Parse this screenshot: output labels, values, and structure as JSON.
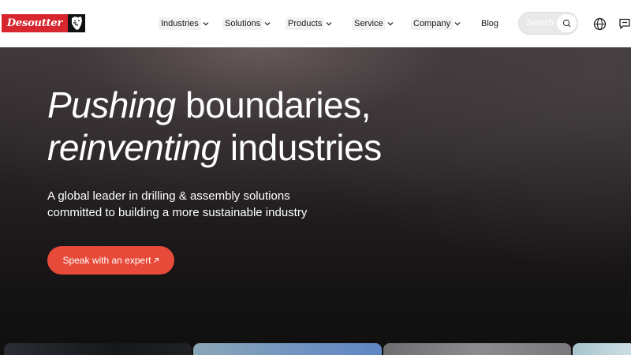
{
  "header": {
    "logo": {
      "text": "Desoutter",
      "mark": "tiger-head-logo-mark"
    },
    "nav": [
      {
        "label": "Industries",
        "has_dropdown": true
      },
      {
        "label": "Solutions",
        "has_dropdown": true
      },
      {
        "label": "Products",
        "has_dropdown": true
      },
      {
        "label": "Service",
        "has_dropdown": true
      },
      {
        "label": "Company",
        "has_dropdown": true
      },
      {
        "label": "Blog",
        "has_dropdown": false
      }
    ],
    "search": {
      "placeholder": "Search",
      "icon": "search-icon"
    },
    "icons": {
      "language": "globe-icon",
      "contact": "chat-icon"
    }
  },
  "hero": {
    "headline_line1_em": "Pushing",
    "headline_line1_rest": " boundaries,",
    "headline_line2_em": "reinventing",
    "headline_line2_rest": " industries",
    "subline_line1": "A global leader in drilling & assembly solutions",
    "subline_line2": "committed to building a more sustainable industry",
    "cta_label": "Speak with an expert",
    "cta_icon": "arrow-up-right-icon"
  },
  "colors": {
    "brand_red": "#d7262e",
    "cta": "#e84a3a",
    "header_bg": "#ffffff",
    "hero_bg": "#141213"
  }
}
